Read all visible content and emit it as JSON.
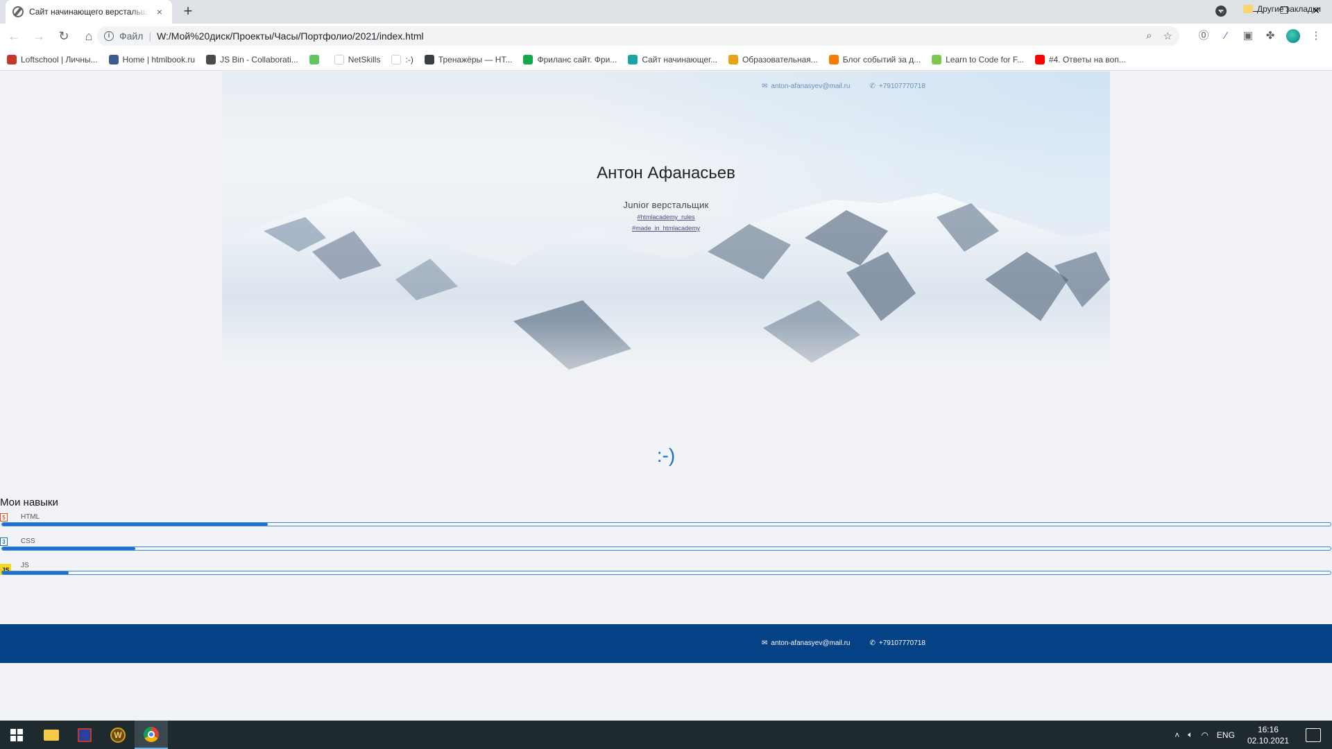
{
  "browser": {
    "tab_title": "Сайт начинающего верстальщ...",
    "tab_close": "×",
    "new_tab": "+",
    "url_scheme": "Файл",
    "url": "W:/Мой%20диск/Проекты/Часы/Портфолио/2021/index.html",
    "bookmarks": [
      {
        "label": "Loftschool | Личны...",
        "color": "#c0392b"
      },
      {
        "label": "Home | htmlbook.ru",
        "color": "#3b5b8e"
      },
      {
        "label": "JS Bin - Collaborati...",
        "color": "#4a4a4a"
      },
      {
        "label": "",
        "color": "#62c462"
      },
      {
        "label": "NetSkills",
        "color": "#ffffff"
      },
      {
        "label": ":-)",
        "color": "#ffffff"
      },
      {
        "label": "Тренажёры — HT...",
        "color": "#3c4043"
      },
      {
        "label": "Фриланс сайт. Фри...",
        "color": "#14a84b"
      },
      {
        "label": "Сайт начинающег...",
        "color": "#1aa5a5"
      },
      {
        "label": "Образовательная...",
        "color": "#e8a317"
      },
      {
        "label": "Блог событий за д...",
        "color": "#f57d00"
      },
      {
        "label": "Learn to Code for F...",
        "color": "#7ec850"
      },
      {
        "label": "#4. Ответы на воп...",
        "color": "#ff0000"
      }
    ],
    "bookmarks_more": "»",
    "other_bookmarks": "Другие закладки"
  },
  "page": {
    "header_email": "anton-afanasyev@mail.ru",
    "header_phone": "+79107770718",
    "name": "Антон Афанасьев",
    "role": "Junior верстальщик",
    "tag1": "#htmlacademy_rules",
    "tag2": "#made_in_htmlacademy",
    "smile": ":-)",
    "skills_title": "Мои навыки",
    "skills": [
      {
        "label": "HTML",
        "icon": "html5-icon",
        "level": 0.2
      },
      {
        "label": "CSS",
        "icon": "css3-icon",
        "level": 0.1
      },
      {
        "label": "JS",
        "icon": "js-icon",
        "level": 0.05
      }
    ],
    "footer_email": "anton-afanasyev@mail.ru",
    "footer_phone": "+79107770718",
    "accent_color": "#1d6fd0",
    "footer_color": "#044185"
  },
  "taskbar": {
    "lang": "ENG",
    "time": "16:16",
    "date": "02.10.2021"
  }
}
